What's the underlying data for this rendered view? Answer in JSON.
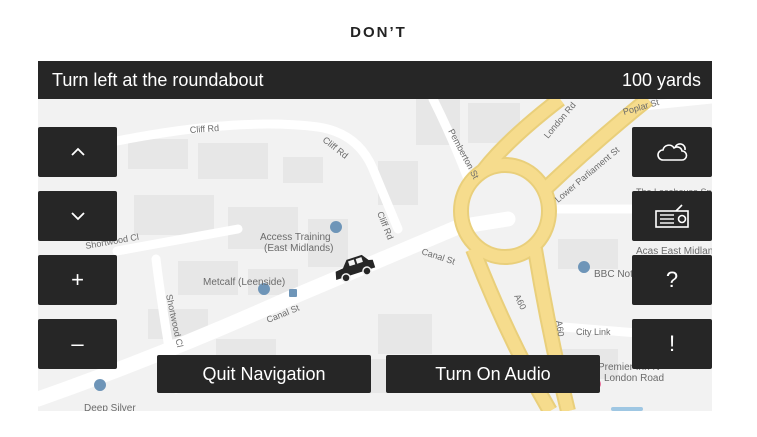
{
  "heading": "DON’T",
  "navigation": {
    "instruction": "Turn left at the roundabout",
    "distance": "100 yards"
  },
  "left_controls": {
    "up_icon": "chevron-up-icon",
    "down_icon": "chevron-down-icon",
    "zoom_in": "+",
    "zoom_out": "–"
  },
  "right_controls": {
    "weather_icon": "cloud-icon",
    "radio_icon": "radio-icon",
    "help": "?",
    "alert": "!"
  },
  "actions": {
    "quit": "Quit Navigation",
    "audio": "Turn On Audio"
  },
  "map_labels": {
    "cliff_rd_1": "Cliff Rd",
    "cliff_rd_2": "Cliff Rd",
    "cliff_rd_3": "Cliff Rd",
    "pemberton": "Pemberton St",
    "london_rd": "London Rd",
    "poplar": "Poplar St",
    "lower_parliament": "Lower Parliament St",
    "access_training_1": "Access Training",
    "access_training_2": "(East Midlands)",
    "canal_st_1": "Canal St",
    "canal_st_2": "Canal St",
    "shortwood_cl_1": "Shortwood Cl",
    "shortwood_cl_2": "Shortwood Cl",
    "metcalf": "Metcalf (Leenside)",
    "a60_1": "A60",
    "a60_2": "A60",
    "city_link": "City Link",
    "bbc": "BBC Notti",
    "acas": "Acas East Midlan",
    "lace": "The Lacehouse Spa",
    "premier_1": "Premier Inn N",
    "premier_2": "London Road",
    "deep_silver": "Deep Silver"
  },
  "colors": {
    "controls": "#262626",
    "map_background": "#f2f2f2",
    "road_major": "#f6dc8d",
    "poi": "#6e95b8"
  }
}
